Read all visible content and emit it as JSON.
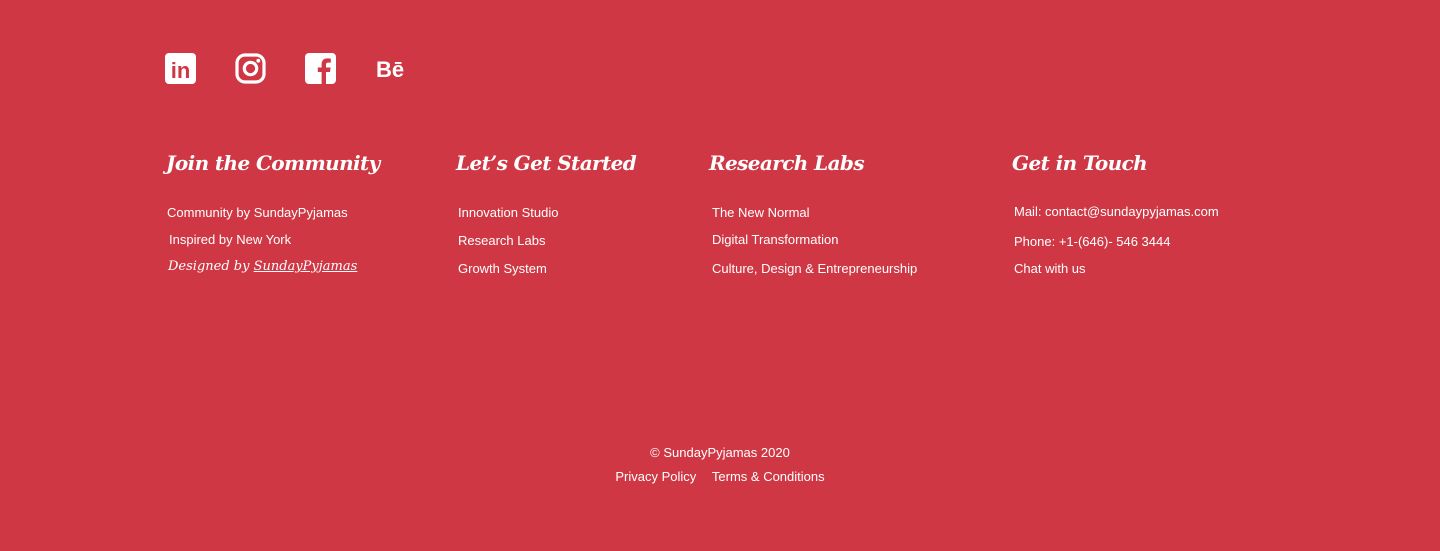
{
  "social": [
    {
      "name": "linkedin-icon",
      "label": "in"
    },
    {
      "name": "instagram-icon"
    },
    {
      "name": "facebook-icon",
      "label": "f"
    },
    {
      "name": "behance-icon",
      "label": "Bē"
    }
  ],
  "columns": [
    {
      "heading": "Join the Community",
      "items": [
        "Community by SundayPyjamas",
        "Inspired by New York"
      ],
      "designed_prefix": "Designed  by",
      "designed_brand": "SundayPyjamas"
    },
    {
      "heading": "Let’s Get Started",
      "items": [
        "Innovation Studio",
        "Research Labs",
        "Growth System"
      ]
    },
    {
      "heading": "Research Labs",
      "items": [
        "The New Normal",
        "Digital Transformation",
        "Culture, Design & Entrepreneurship"
      ]
    },
    {
      "heading": "Get in Touch",
      "items": [
        "Mail: contact@sundaypyjamas.com",
        "Phone: +1-(646)- 546 3444",
        "Chat with us"
      ]
    }
  ],
  "footer": {
    "copyright": "© SundayPyjamas 2020",
    "privacy": "Privacy Policy",
    "terms": "Terms & Conditions"
  },
  "colors": {
    "background": "#cf3744",
    "text": "#ffffff"
  }
}
